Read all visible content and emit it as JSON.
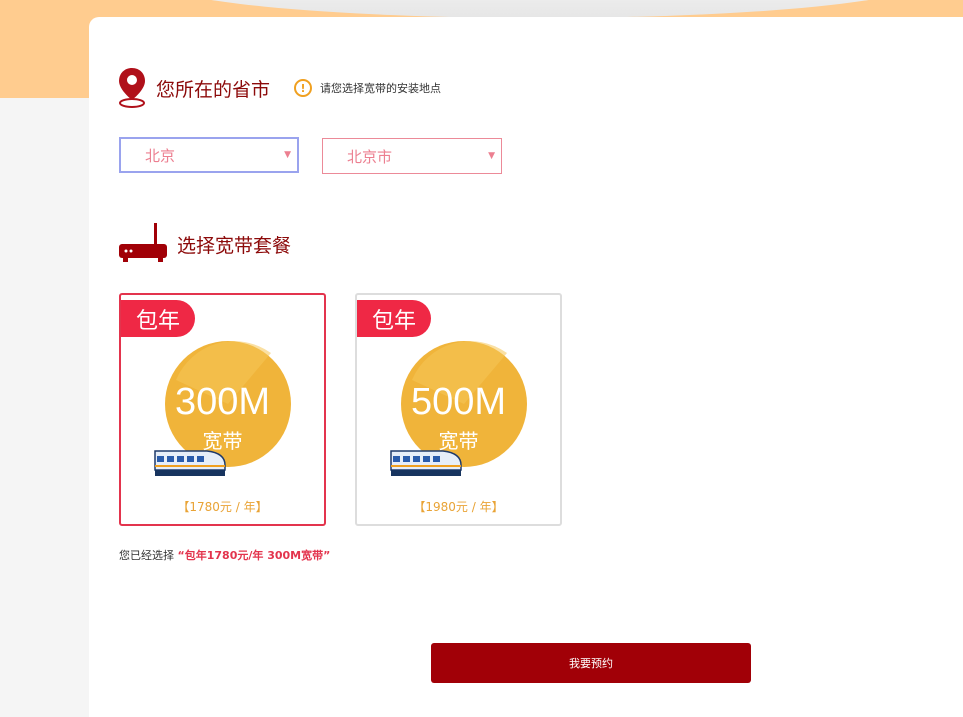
{
  "location": {
    "title": "您所在的省市",
    "hint": "请您选择宽带的安装地点",
    "province": "北京",
    "city": "北京市"
  },
  "packages_section": {
    "title": "选择宽带套餐",
    "items": [
      {
        "tag": "包年",
        "speed": "300M",
        "sub": "宽带",
        "price": "【1780元 / 年】"
      },
      {
        "tag": "包年",
        "speed": "500M",
        "sub": "宽带",
        "price": "【1980元 / 年】"
      }
    ]
  },
  "selection": {
    "prefix": "您已经选择",
    "value": "“包年1780元/年 300M宽带”"
  },
  "submit_label": "我要预约",
  "colors": {
    "brand_red": "#a10007",
    "tag_red": "#ef2845",
    "gold": "#e9a335",
    "header_orange": "#ffcc8f"
  }
}
